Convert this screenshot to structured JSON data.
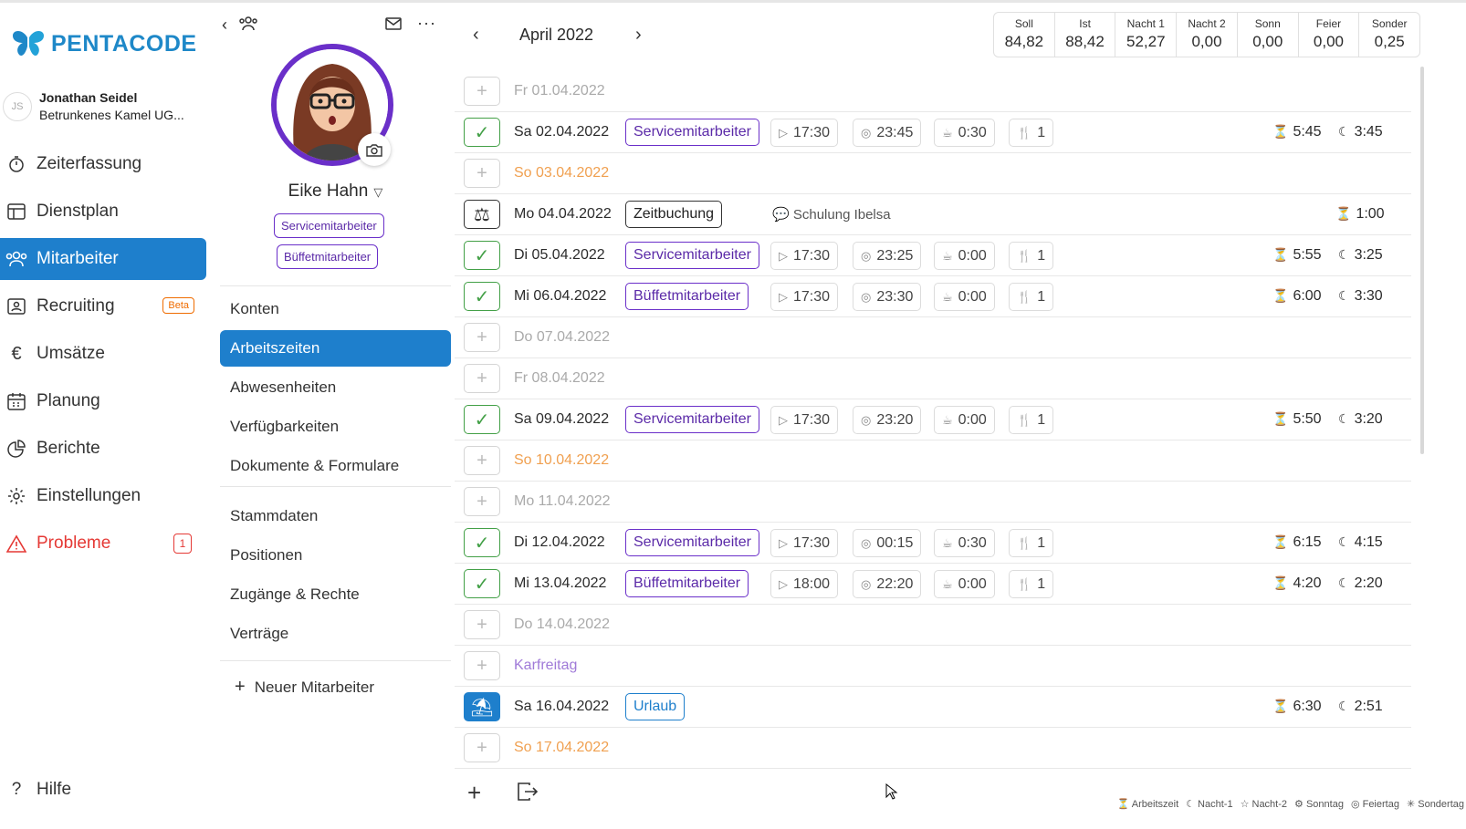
{
  "app": {
    "logo_text": "PENTACODE",
    "brand_color": "#1e7fcc"
  },
  "user": {
    "initials": "JS",
    "name": "Jonathan Seidel",
    "company": "Betrunkenes Kamel UG..."
  },
  "nav": {
    "items": [
      {
        "label": "Zeiterfassung",
        "icon": "stopwatch-icon"
      },
      {
        "label": "Dienstplan",
        "icon": "table-icon"
      },
      {
        "label": "Mitarbeiter",
        "icon": "users-icon",
        "active": true
      },
      {
        "label": "Recruiting",
        "icon": "id-card-icon",
        "badge": "Beta"
      },
      {
        "label": "Umsätze",
        "icon": "euro-icon"
      },
      {
        "label": "Planung",
        "icon": "calendar-icon"
      },
      {
        "label": "Berichte",
        "icon": "pie-chart-icon"
      },
      {
        "label": "Einstellungen",
        "icon": "gear-icon"
      },
      {
        "label": "Probleme",
        "icon": "warning-icon",
        "count": "1"
      }
    ],
    "help": "Hilfe"
  },
  "profile": {
    "name": "Eike Hahn",
    "roles": [
      "Servicemitarbeiter",
      "Büffetmitarbeiter"
    ],
    "menu_primary": [
      "Konten",
      "Arbeitszeiten",
      "Abwesenheiten",
      "Verfügbarkeiten",
      "Dokumente & Formulare"
    ],
    "menu_secondary": [
      "Stammdaten",
      "Positionen",
      "Zugänge & Rechte",
      "Verträge"
    ],
    "new_employee": "Neuer Mitarbeiter"
  },
  "month": {
    "label": "April 2022"
  },
  "summary": [
    {
      "label": "Soll",
      "value": "84,82"
    },
    {
      "label": "Ist",
      "value": "88,42"
    },
    {
      "label": "Nacht 1",
      "value": "52,27"
    },
    {
      "label": "Nacht 2",
      "value": "0,00"
    },
    {
      "label": "Sonn",
      "value": "0,00"
    },
    {
      "label": "Feier",
      "value": "0,00"
    },
    {
      "label": "Sonder",
      "value": "0,25"
    }
  ],
  "rows": [
    {
      "day": "Fr  01.04.2022",
      "kind": "empty"
    },
    {
      "day": "Sa  02.04.2022",
      "kind": "shift",
      "tag": "Servicemitarbeiter",
      "start": "17:30",
      "end": "23:45",
      "break": "0:30",
      "meal": "1",
      "work": "5:45",
      "night": "3:45"
    },
    {
      "day": "So  03.04.2022",
      "kind": "sunday"
    },
    {
      "day": "Mo  04.04.2022",
      "kind": "booking",
      "tag": "Zeitbuchung",
      "comment": "Schulung Ibelsa",
      "work": "1:00"
    },
    {
      "day": "Di  05.04.2022",
      "kind": "shift",
      "tag": "Servicemitarbeiter",
      "start": "17:30",
      "end": "23:25",
      "break": "0:00",
      "meal": "1",
      "work": "5:55",
      "night": "3:25"
    },
    {
      "day": "Mi  06.04.2022",
      "kind": "shift",
      "tag": "Büffetmitarbeiter",
      "start": "17:30",
      "end": "23:30",
      "break": "0:00",
      "meal": "1",
      "work": "6:00",
      "night": "3:30"
    },
    {
      "day": "Do  07.04.2022",
      "kind": "empty"
    },
    {
      "day": "Fr  08.04.2022",
      "kind": "empty"
    },
    {
      "day": "Sa  09.04.2022",
      "kind": "shift",
      "tag": "Servicemitarbeiter",
      "start": "17:30",
      "end": "23:20",
      "break": "0:00",
      "meal": "1",
      "work": "5:50",
      "night": "3:20"
    },
    {
      "day": "So  10.04.2022",
      "kind": "sunday"
    },
    {
      "day": "Mo  11.04.2022",
      "kind": "empty"
    },
    {
      "day": "Di  12.04.2022",
      "kind": "shift",
      "tag": "Servicemitarbeiter",
      "start": "17:30",
      "end": "00:15",
      "break": "0:30",
      "meal": "1",
      "work": "6:15",
      "night": "4:15"
    },
    {
      "day": "Mi  13.04.2022",
      "kind": "shift",
      "tag": "Büffetmitarbeiter",
      "start": "18:00",
      "end": "22:20",
      "break": "0:00",
      "meal": "1",
      "work": "4:20",
      "night": "2:20"
    },
    {
      "day": "Do  14.04.2022",
      "kind": "empty"
    },
    {
      "day": "Karfreitag",
      "kind": "holiday"
    },
    {
      "day": "Sa  16.04.2022",
      "kind": "vacation",
      "tag": "Urlaub",
      "work": "6:30",
      "night": "2:51"
    },
    {
      "day": "So  17.04.2022",
      "kind": "sunday"
    }
  ],
  "legend": [
    "Arbeitszeit",
    "Nacht-1",
    "Nacht-2",
    "Sonntag",
    "Feiertag",
    "Sondertag"
  ]
}
